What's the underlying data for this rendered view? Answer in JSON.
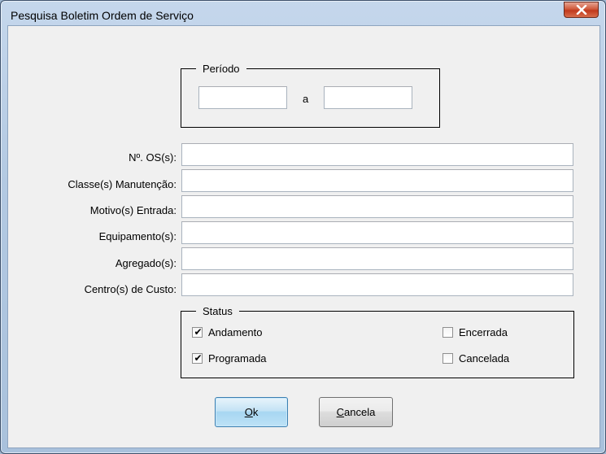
{
  "window": {
    "title": "Pesquisa Boletim Ordem de Serviço",
    "close_glyph": "✕"
  },
  "periodo": {
    "legend": "Período",
    "separator": "a",
    "start_value": "",
    "end_value": ""
  },
  "fields": [
    {
      "label": "Nº. OS(s):",
      "value": ""
    },
    {
      "label": "Classe(s) Manutenção:",
      "value": ""
    },
    {
      "label": "Motivo(s) Entrada:",
      "value": ""
    },
    {
      "label": "Equipamento(s):",
      "value": ""
    },
    {
      "label": "Agregado(s):",
      "value": ""
    },
    {
      "label": "Centro(s) de Custo:",
      "value": ""
    }
  ],
  "status": {
    "legend": "Status",
    "options": [
      {
        "label": "Andamento",
        "checked": true
      },
      {
        "label": "Programada",
        "checked": true
      },
      {
        "label": "Encerrada",
        "checked": false
      },
      {
        "label": "Cancelada",
        "checked": false
      }
    ]
  },
  "buttons": {
    "ok_accel": "O",
    "ok_rest": "k",
    "cancel_accel": "C",
    "cancel_rest": "ancela"
  },
  "colors": {
    "close_button": "#c7432a",
    "default_button": "#a7d6f2",
    "dialog_background": "#f0f0f0"
  },
  "icons": {
    "close": "close-icon",
    "checkmark": "checkmark-icon"
  }
}
